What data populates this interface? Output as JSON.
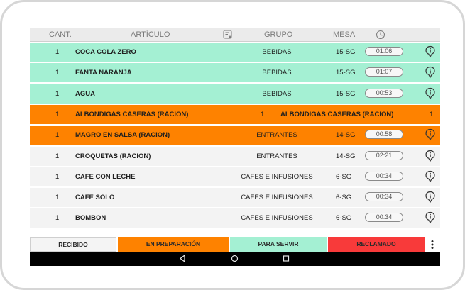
{
  "colors": {
    "served": "#a4f0d3",
    "preparing": "#fe8200",
    "neutral": "#f3f3f3",
    "claimed": "#f83a3a"
  },
  "header": {
    "cant": "CANT.",
    "articulo": "ARTÍCULO",
    "note_icon": "order-notes-icon",
    "grupo": "GRUPO",
    "mesa": "MESA",
    "timer_icon": "clock-icon"
  },
  "rows": [
    {
      "qty": "1",
      "article": "COCA COLA ZERO",
      "group": "BEBIDAS",
      "table": "15-SG",
      "time": "01:06",
      "status": "served"
    },
    {
      "qty": "1",
      "article": "FANTA NARANJA",
      "group": "BEBIDAS",
      "table": "15-SG",
      "time": "01:07",
      "status": "served"
    },
    {
      "qty": "1",
      "article": "AGUA",
      "group": "BEBIDAS",
      "table": "15-SG",
      "time": "00:53",
      "status": "served"
    },
    {
      "qty": "1",
      "article": "ALBONDIGAS CASERAS (RACION)",
      "qty2": "1",
      "article2": "ALBONDIGAS CASERAS (RACION)",
      "qty3": "1",
      "status": "preparing"
    },
    {
      "qty": "1",
      "article": "MAGRO EN SALSA (RACION)",
      "group": "ENTRANTES",
      "table": "14-SG",
      "time": "00:58",
      "status": "preparing"
    },
    {
      "qty": "1",
      "article": "CROQUETAS (RACION)",
      "group": "ENTRANTES",
      "table": "14-SG",
      "time": "02:21",
      "status": "neutral"
    },
    {
      "qty": "1",
      "article": "CAFE CON LECHE",
      "group": "CAFES E INFUSIONES",
      "table": "6-SG",
      "time": "00:34",
      "status": "neutral"
    },
    {
      "qty": "1",
      "article": "CAFE SOLO",
      "group": "CAFES E INFUSIONES",
      "table": "6-SG",
      "time": "00:34",
      "status": "neutral"
    },
    {
      "qty": "1",
      "article": "BOMBON",
      "group": "CAFES E INFUSIONES",
      "table": "6-SG",
      "time": "00:34",
      "status": "neutral"
    }
  ],
  "footer": {
    "recibido": "RECIBIDO",
    "en_preparacion": "EN PREPARACIÓN",
    "para_servir": "PARA SERVIR",
    "reclamado": "RECLAMADO",
    "more_icon": "more-vert-icon"
  },
  "navbar": {
    "back_icon": "back-triangle-icon",
    "home_icon": "home-circle-icon",
    "recents_icon": "recents-square-icon"
  }
}
